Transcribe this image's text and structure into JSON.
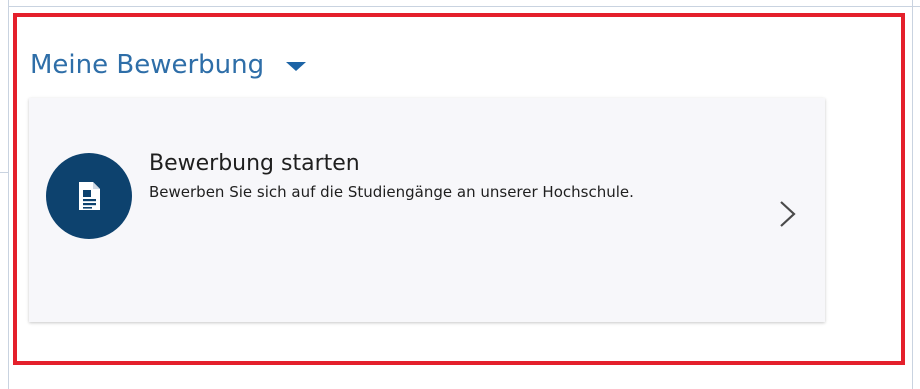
{
  "section": {
    "title": "Meine Bewerbung",
    "toggle_icon": "chevron-down-icon"
  },
  "card": {
    "title": "Bewerbung starten",
    "description": "Bewerben Sie sich auf die Studiengänge an unserer Hochschule.",
    "icon": "document-icon",
    "arrow_icon": "chevron-right-icon"
  },
  "colors": {
    "accent": "#2e6ea8",
    "icon_circle": "#0d426e",
    "highlight": "#e4202b",
    "card_bg": "#f7f7fa"
  }
}
